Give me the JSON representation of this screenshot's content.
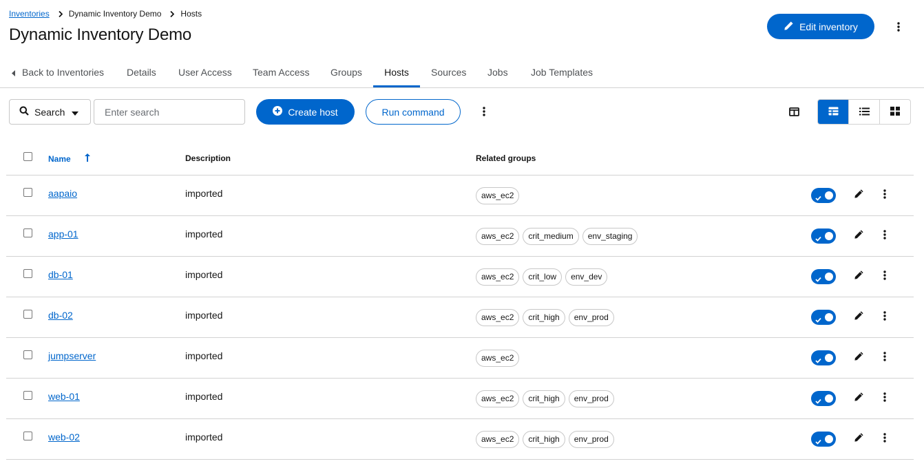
{
  "breadcrumb": {
    "items": [
      "Inventories",
      "Dynamic Inventory Demo",
      "Hosts"
    ]
  },
  "header": {
    "title": "Dynamic Inventory Demo",
    "edit_label": "Edit inventory"
  },
  "tabs": [
    {
      "label": "Back to Inventories",
      "active": false
    },
    {
      "label": "Details",
      "active": false
    },
    {
      "label": "User Access",
      "active": false
    },
    {
      "label": "Team Access",
      "active": false
    },
    {
      "label": "Groups",
      "active": false
    },
    {
      "label": "Hosts",
      "active": true
    },
    {
      "label": "Sources",
      "active": false
    },
    {
      "label": "Jobs",
      "active": false
    },
    {
      "label": "Job Templates",
      "active": false
    }
  ],
  "toolbar": {
    "search_filter_label": "Search",
    "search_placeholder": "Enter search",
    "create_label": "Create host",
    "run_label": "Run command",
    "active_view": "table"
  },
  "table": {
    "columns": [
      "Name",
      "Description",
      "Related groups"
    ],
    "sort_column": "Name",
    "rows": [
      {
        "name": "aapaio",
        "description": "imported",
        "groups": [
          "aws_ec2"
        ],
        "enabled": true
      },
      {
        "name": "app-01",
        "description": "imported",
        "groups": [
          "aws_ec2",
          "crit_medium",
          "env_staging"
        ],
        "enabled": true
      },
      {
        "name": "db-01",
        "description": "imported",
        "groups": [
          "aws_ec2",
          "crit_low",
          "env_dev"
        ],
        "enabled": true
      },
      {
        "name": "db-02",
        "description": "imported",
        "groups": [
          "aws_ec2",
          "crit_high",
          "env_prod"
        ],
        "enabled": true
      },
      {
        "name": "jumpserver",
        "description": "imported",
        "groups": [
          "aws_ec2"
        ],
        "enabled": true
      },
      {
        "name": "web-01",
        "description": "imported",
        "groups": [
          "aws_ec2",
          "crit_high",
          "env_prod"
        ],
        "enabled": true
      },
      {
        "name": "web-02",
        "description": "imported",
        "groups": [
          "aws_ec2",
          "crit_high",
          "env_prod"
        ],
        "enabled": true
      }
    ]
  },
  "colors": {
    "primary": "#0066cc",
    "text": "#151515",
    "border": "#d2d2d2"
  }
}
